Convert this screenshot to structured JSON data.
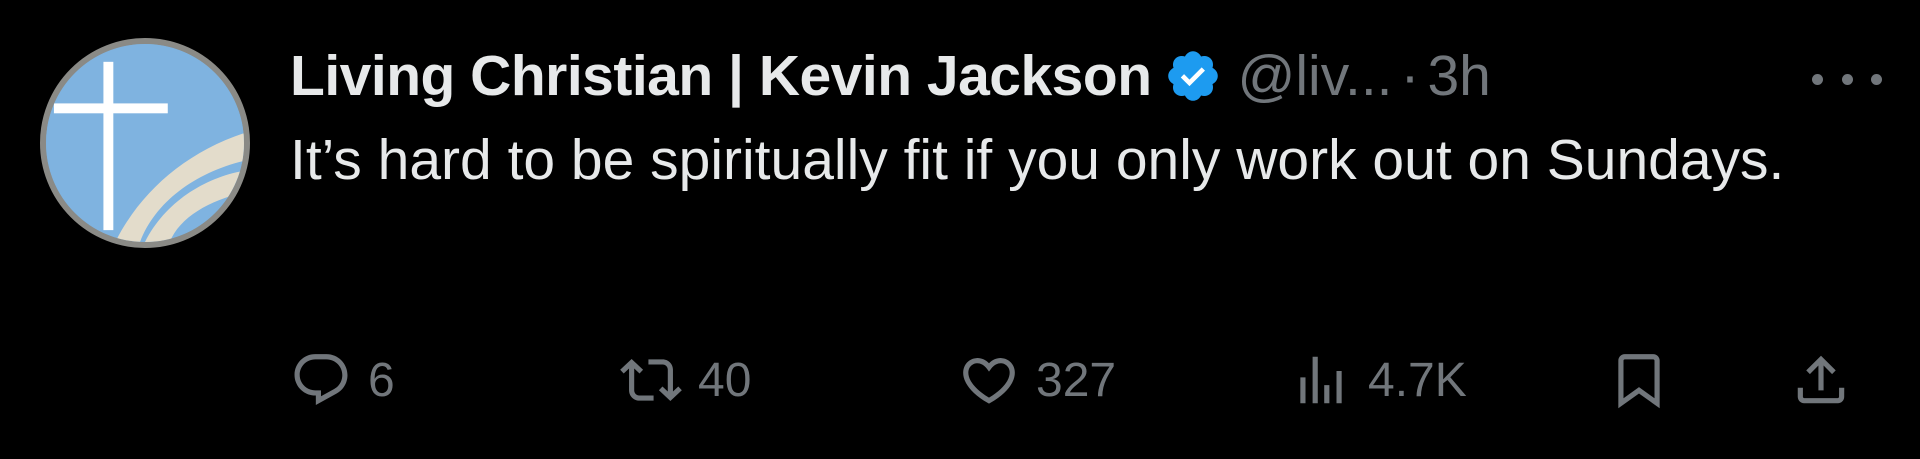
{
  "author": {
    "display_name": "Living Christian | Kevin Jackson",
    "handle": "@liv...",
    "separator": "·",
    "time": "3h",
    "verified": true
  },
  "tweet": {
    "text": "It’s hard to be spiritually fit if you only work out on Sundays."
  },
  "actions": {
    "replies": "6",
    "retweets": "40",
    "likes": "327",
    "views": "4.7K"
  },
  "icons": {
    "reply": "reply-icon",
    "retweet": "retweet-icon",
    "like": "heart-icon",
    "views": "views-icon",
    "bookmark": "bookmark-icon",
    "share": "share-icon",
    "more": "more-icon",
    "verified": "verified-badge-icon"
  },
  "colors": {
    "background": "#000000",
    "primary_text": "#e7e9ea",
    "secondary_text": "#71767b",
    "verified_blue": "#1d9bf0",
    "avatar_blue": "#7fb3e0"
  }
}
